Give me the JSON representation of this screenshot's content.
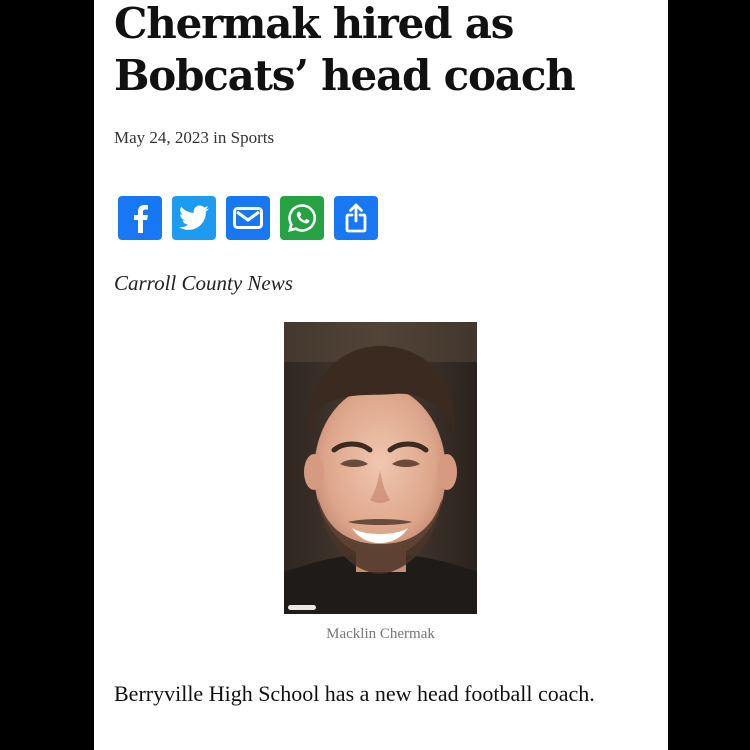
{
  "article": {
    "headline": "Chermak hired as Bobcats’ head coach",
    "meta": "May 24, 2023 in Sports",
    "source": "Carroll County News",
    "photo_caption": "Macklin Chermak",
    "body_paragraph": "Berryville High School has a new head football coach."
  },
  "share": [
    {
      "icon": "facebook-icon",
      "color": "#1877f2"
    },
    {
      "icon": "twitter-icon",
      "color": "#1d9bf0"
    },
    {
      "icon": "email-icon",
      "color": "#1877f2"
    },
    {
      "icon": "whatsapp-icon",
      "color": "#25a244"
    },
    {
      "icon": "share-icon",
      "color": "#1877f2"
    }
  ]
}
